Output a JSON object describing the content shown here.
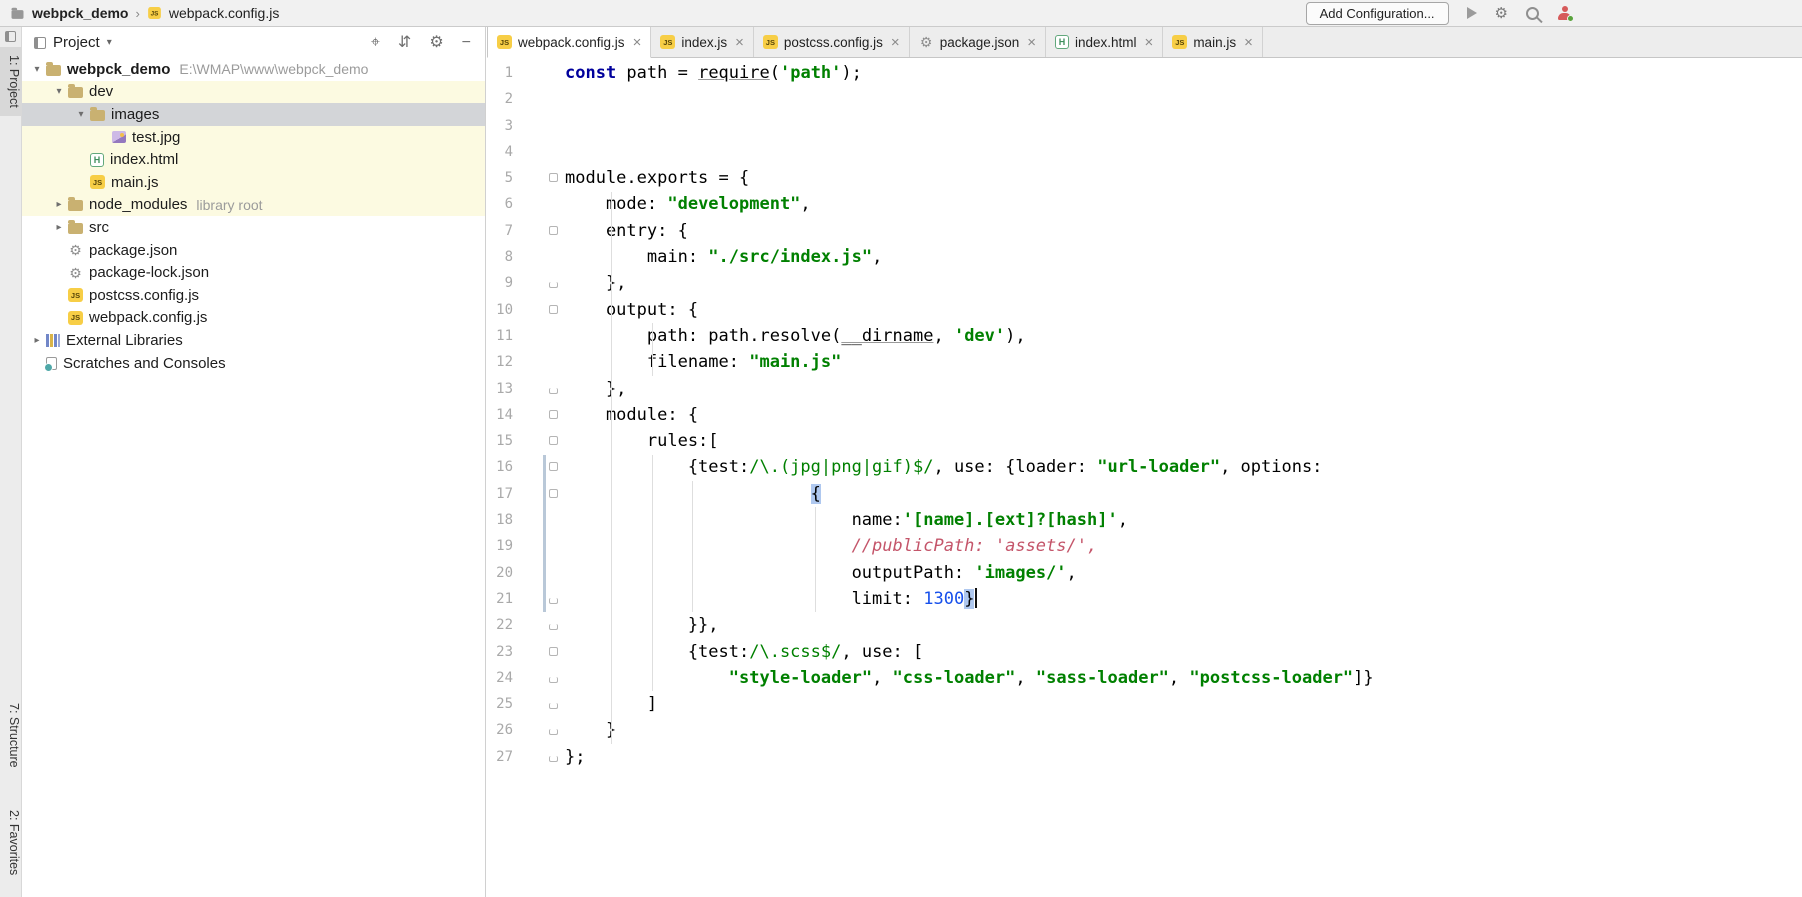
{
  "titlebar": {
    "breadcrumb": {
      "project": "webpck_demo",
      "separator": "›",
      "file": "webpack.config.js"
    },
    "add_configuration_label": "Add Configuration...",
    "icons": [
      "run-icon",
      "settings-icon",
      "search-everywhere-icon",
      "profile-icon"
    ]
  },
  "tool_strip": {
    "top": [
      {
        "label": "1: Project",
        "active": true
      }
    ],
    "bottom": [
      {
        "label": "7: Structure"
      },
      {
        "label": "2: Favorites"
      }
    ]
  },
  "glyphs": {
    "chevron_down": "▾",
    "chevron_right": "▸",
    "project_caret": "▾",
    "close": "×",
    "locate": "⌖",
    "collapse_all": "⇵",
    "gear": "⚙",
    "hide": "−"
  },
  "colors": {
    "cream_row": "#FCFAE1",
    "selected_row": "#D3D5D8",
    "folder_icon": "#C9B171",
    "js_icon": "#F7CE46",
    "keyword": "#00009C",
    "string": "#008000",
    "number": "#1750EB",
    "comment": "#C4556A",
    "brace_highlight": "#AFC8EF"
  },
  "project_panel": {
    "header": {
      "title": "Project",
      "icons": [
        "locate-icon",
        "collapse-all-icon",
        "settings-icon",
        "hide-icon"
      ]
    },
    "tree": [
      {
        "level": 0,
        "chevron": "down",
        "icon": "folder",
        "label": "webpck_demo",
        "bold": true,
        "annotation": "E:\\WMAP\\www\\webpck_demo",
        "bg": "none"
      },
      {
        "level": 1,
        "chevron": "down",
        "icon": "folder",
        "label": "dev",
        "bg": "cream"
      },
      {
        "level": 2,
        "chevron": "down",
        "icon": "folder",
        "label": "images",
        "bg": "selected"
      },
      {
        "level": 3,
        "chevron": null,
        "icon": "image",
        "label": "test.jpg",
        "bg": "cream"
      },
      {
        "level": 2,
        "chevron": null,
        "icon": "html",
        "label": "index.html",
        "bg": "cream"
      },
      {
        "level": 2,
        "chevron": null,
        "icon": "js",
        "label": "main.js",
        "bg": "cream"
      },
      {
        "level": 1,
        "chevron": "right",
        "icon": "folder",
        "label": "node_modules",
        "annotation": "library root",
        "bg": "cream"
      },
      {
        "level": 1,
        "chevron": "right",
        "icon": "folder",
        "label": "src",
        "bg": "none"
      },
      {
        "level": 1,
        "chevron": null,
        "icon": "json",
        "label": "package.json",
        "bg": "none"
      },
      {
        "level": 1,
        "chevron": null,
        "icon": "json",
        "label": "package-lock.json",
        "bg": "none"
      },
      {
        "level": 1,
        "chevron": null,
        "icon": "js",
        "label": "postcss.config.js",
        "bg": "none"
      },
      {
        "level": 1,
        "chevron": null,
        "icon": "js",
        "label": "webpack.config.js",
        "bg": "none"
      },
      {
        "level": 0,
        "chevron": "right",
        "icon": "libraries",
        "label": "External Libraries",
        "bg": "none"
      },
      {
        "level": 0,
        "chevron": null,
        "icon": "scratches",
        "label": "Scratches and Consoles",
        "bg": "none"
      }
    ]
  },
  "editor": {
    "tabs": [
      {
        "label": "webpack.config.js",
        "icon": "js",
        "active": true
      },
      {
        "label": "index.js",
        "icon": "js",
        "active": false
      },
      {
        "label": "postcss.config.js",
        "icon": "js",
        "active": false
      },
      {
        "label": "package.json",
        "icon": "json",
        "active": false
      },
      {
        "label": "index.html",
        "icon": "html",
        "active": false
      },
      {
        "label": "main.js",
        "icon": "js",
        "active": false
      }
    ],
    "vcs_marker": {
      "from": 16,
      "to": 21
    },
    "guides": [
      {
        "col": 4,
        "from": 6,
        "to": 26
      },
      {
        "col": 8,
        "from": 11,
        "to": 12
      },
      {
        "col": 8,
        "from": 16,
        "to": 24
      },
      {
        "col": 12,
        "from": 17,
        "to": 21
      },
      {
        "col": 24,
        "from": 18,
        "to": 21
      }
    ],
    "lines": [
      {
        "n": 1,
        "fold": null,
        "segs": [
          [
            "k",
            "const"
          ],
          [
            "p",
            " path = "
          ],
          [
            "u",
            "require"
          ],
          [
            "p",
            "("
          ],
          [
            "s",
            "'path'"
          ],
          [
            "p",
            ");"
          ]
        ]
      },
      {
        "n": 2,
        "fold": null,
        "segs": []
      },
      {
        "n": 3,
        "fold": null,
        "segs": []
      },
      {
        "n": 4,
        "fold": null,
        "segs": []
      },
      {
        "n": 5,
        "fold": "start",
        "segs": [
          [
            "p",
            "module.exports = {"
          ]
        ]
      },
      {
        "n": 6,
        "fold": null,
        "segs": [
          [
            "p",
            "    mode: "
          ],
          [
            "s",
            "\"development\""
          ],
          [
            "p",
            ","
          ]
        ]
      },
      {
        "n": 7,
        "fold": "start",
        "segs": [
          [
            "p",
            "    entry: {"
          ]
        ]
      },
      {
        "n": 8,
        "fold": null,
        "segs": [
          [
            "p",
            "        main: "
          ],
          [
            "s",
            "\"./src/index.js\""
          ],
          [
            "p",
            ","
          ]
        ]
      },
      {
        "n": 9,
        "fold": "end",
        "segs": [
          [
            "p",
            "    },"
          ]
        ]
      },
      {
        "n": 10,
        "fold": "start",
        "segs": [
          [
            "p",
            "    output: {"
          ]
        ]
      },
      {
        "n": 11,
        "fold": null,
        "segs": [
          [
            "p",
            "        path: path.resolve("
          ],
          [
            "u",
            "__dirname"
          ],
          [
            "p",
            ", "
          ],
          [
            "s",
            "'dev'"
          ],
          [
            "p",
            "),"
          ]
        ]
      },
      {
        "n": 12,
        "fold": null,
        "segs": [
          [
            "p",
            "        filename: "
          ],
          [
            "s",
            "\"main.js\""
          ]
        ]
      },
      {
        "n": 13,
        "fold": "end",
        "segs": [
          [
            "p",
            "    },"
          ]
        ]
      },
      {
        "n": 14,
        "fold": "start",
        "segs": [
          [
            "p",
            "    module: {"
          ]
        ]
      },
      {
        "n": 15,
        "fold": "start",
        "segs": [
          [
            "p",
            "        rules:["
          ]
        ]
      },
      {
        "n": 16,
        "fold": "start",
        "segs": [
          [
            "p",
            "            {test:"
          ],
          [
            "r",
            "/\\.(jpg|png|gif)$/"
          ],
          [
            "p",
            ", use: {loader: "
          ],
          [
            "s",
            "\"url-loader\""
          ],
          [
            "p",
            ", options:"
          ]
        ]
      },
      {
        "n": 17,
        "fold": "start",
        "segs": [
          [
            "p",
            "                        "
          ],
          [
            "hb",
            "{"
          ]
        ]
      },
      {
        "n": 18,
        "fold": null,
        "segs": [
          [
            "p",
            "                            name:"
          ],
          [
            "s",
            "'[name].[ext]?[hash]'"
          ],
          [
            "p",
            ","
          ]
        ]
      },
      {
        "n": 19,
        "fold": null,
        "segs": [
          [
            "c",
            "                            //publicPath: 'assets/',"
          ]
        ]
      },
      {
        "n": 20,
        "fold": null,
        "segs": [
          [
            "p",
            "                            outputPath: "
          ],
          [
            "s",
            "'images/'"
          ],
          [
            "p",
            ","
          ]
        ]
      },
      {
        "n": 21,
        "fold": "end",
        "segs": [
          [
            "p",
            "                            limit: "
          ],
          [
            "n",
            "1300"
          ],
          [
            "hb",
            "}"
          ],
          [
            "caret",
            ""
          ]
        ]
      },
      {
        "n": 22,
        "fold": "end",
        "segs": [
          [
            "p",
            "            }},"
          ]
        ]
      },
      {
        "n": 23,
        "fold": "start",
        "segs": [
          [
            "p",
            "            {test:"
          ],
          [
            "r",
            "/\\.scss$/"
          ],
          [
            "p",
            ", use: ["
          ]
        ]
      },
      {
        "n": 24,
        "fold": "end",
        "segs": [
          [
            "p",
            "                "
          ],
          [
            "s",
            "\"style-loader\""
          ],
          [
            "p",
            ", "
          ],
          [
            "s",
            "\"css-loader\""
          ],
          [
            "p",
            ", "
          ],
          [
            "s",
            "\"sass-loader\""
          ],
          [
            "p",
            ", "
          ],
          [
            "s",
            "\"postcss-loader\""
          ],
          [
            "p",
            "]}"
          ]
        ]
      },
      {
        "n": 25,
        "fold": "end",
        "segs": [
          [
            "p",
            "        ]"
          ]
        ]
      },
      {
        "n": 26,
        "fold": "end",
        "segs": [
          [
            "p",
            "    }"
          ]
        ]
      },
      {
        "n": 27,
        "fold": "end",
        "segs": [
          [
            "p",
            "};"
          ]
        ]
      }
    ]
  }
}
